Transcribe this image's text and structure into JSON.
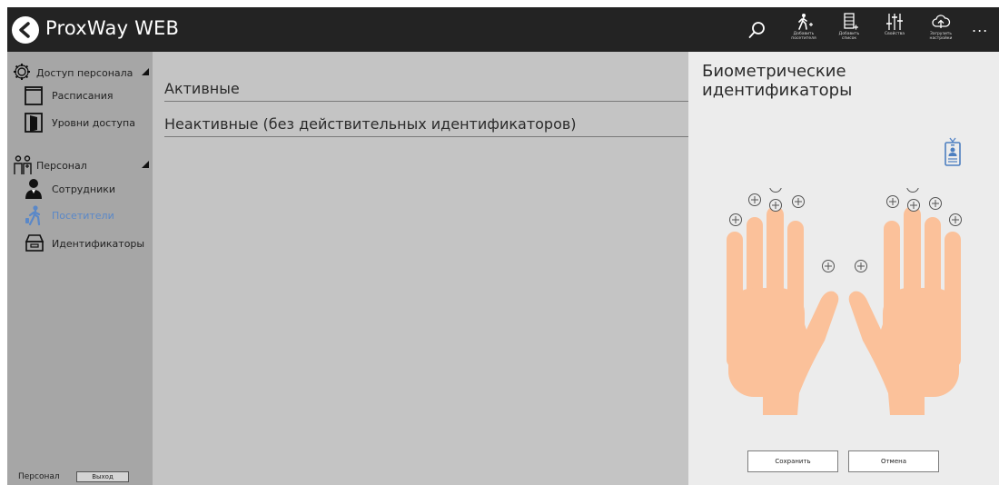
{
  "app": {
    "title": "ProxWay WEB"
  },
  "toolbar": {
    "items": [
      {
        "icon": "walking-person-plus-icon",
        "label": "Добавить\nпосетителя"
      },
      {
        "icon": "list-plus-icon",
        "label": "Добавить\nсписок"
      },
      {
        "icon": "sliders-icon",
        "label": "Свойства"
      },
      {
        "icon": "cloud-upload-icon",
        "label": "Загрузить\nнастройки"
      }
    ],
    "more": "..."
  },
  "sidebar": {
    "sections": [
      {
        "label": "Доступ персонала",
        "icon": "gear-icon",
        "items": [
          {
            "label": "Расписания",
            "icon": "calendar-icon",
            "active": false
          },
          {
            "label": "Уровни доступа",
            "icon": "door-icon",
            "active": false
          }
        ]
      },
      {
        "label": "Персонал",
        "icon": "people-icon",
        "items": [
          {
            "label": "Сотрудники",
            "icon": "employee-icon",
            "active": false
          },
          {
            "label": "Посетители",
            "icon": "visitor-icon",
            "active": true
          },
          {
            "label": "Идентификаторы",
            "icon": "card-reader-icon",
            "active": false
          }
        ]
      }
    ],
    "footer": {
      "label": "Персонал",
      "logout_label": "Выход"
    }
  },
  "main": {
    "groups": [
      {
        "label": "Активные"
      },
      {
        "label": "Неактивные (без действительных идентификаторов)"
      }
    ]
  },
  "panel": {
    "title": "Биометрические идентификаторы",
    "save_label": "Сохранить",
    "cancel_label": "Отмена"
  },
  "colors": {
    "header_bg": "#232323",
    "sidebar_bg": "#a6a6a6",
    "main_bg": "#c4c4c4",
    "panel_bg": "#ececec",
    "accent": "#5a88c8",
    "hand": "#fbc19a"
  }
}
